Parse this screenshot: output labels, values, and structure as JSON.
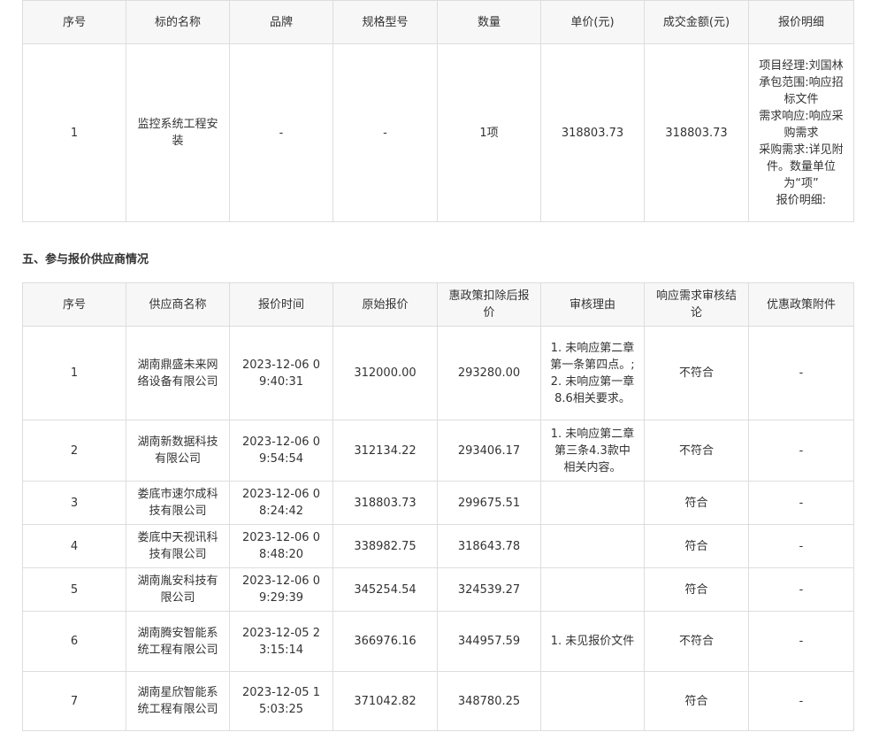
{
  "table1": {
    "headers": [
      "序号",
      "标的名称",
      "品牌",
      "规格型号",
      "数量",
      "单价(元)",
      "成交金额(元)",
      "报价明细"
    ],
    "rows": [
      [
        "1",
        "监控系统工程安装",
        "-",
        "-",
        "1项",
        "318803.73",
        "318803.73",
        "项目经理:刘国林\n承包范围:响应招标文件\n需求响应:响应采购需求\n采购需求:详见附件。数量单位为“项”\n报价明细:"
      ]
    ]
  },
  "section_title": "五、参与报价供应商情况",
  "table2": {
    "headers": [
      "序号",
      "供应商名称",
      "报价时间",
      "原始报价",
      "惠政策扣除后报价",
      "审核理由",
      "响应需求审核结论",
      "优惠政策附件"
    ],
    "rows": [
      [
        "1",
        "湖南鼎盛未来网络设备有限公司",
        "2023-12-06 09:40:31",
        "312000.00",
        "293280.00",
        "1. 未响应第二章第一条第四点。; 2. 未响应第一章8.6相关要求。",
        "不符合",
        "-"
      ],
      [
        "2",
        "湖南新数据科技有限公司",
        "2023-12-06 09:54:54",
        "312134.22",
        "293406.17",
        "1. 未响应第二章第三条4.3款中相关内容。",
        "不符合",
        "-"
      ],
      [
        "3",
        "娄底市速尔成科技有限公司",
        "2023-12-06 08:24:42",
        "318803.73",
        "299675.51",
        "",
        "符合",
        "-"
      ],
      [
        "4",
        "娄底中天视讯科技有限公司",
        "2023-12-06 08:48:20",
        "338982.75",
        "318643.78",
        "",
        "符合",
        "-"
      ],
      [
        "5",
        "湖南胤安科技有限公司",
        "2023-12-06 09:29:39",
        "345254.54",
        "324539.27",
        "",
        "符合",
        "-"
      ],
      [
        "6",
        "湖南腾安智能系统工程有限公司",
        "2023-12-05 23:15:14",
        "366976.16",
        "344957.59",
        "1. 未见报价文件",
        "不符合",
        "-"
      ],
      [
        "7",
        "湖南星欣智能系统工程有限公司",
        "2023-12-05 15:03:25",
        "371042.82",
        "348780.25",
        "",
        "符合",
        "-"
      ]
    ]
  }
}
